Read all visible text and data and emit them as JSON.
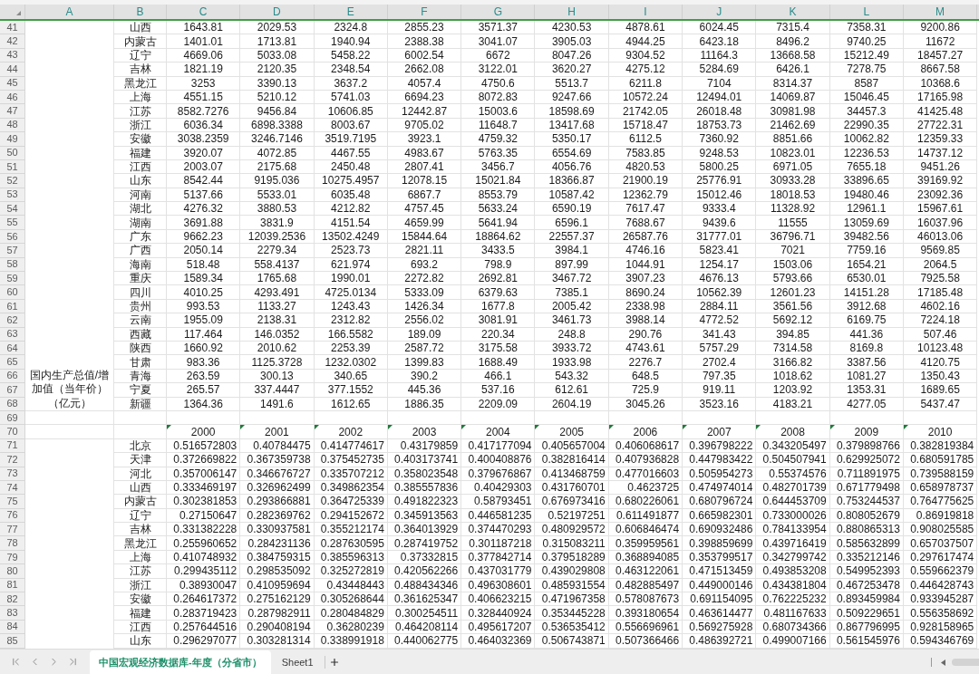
{
  "column_headers": [
    "A",
    "B",
    "C",
    "D",
    "E",
    "F",
    "G",
    "H",
    "I",
    "J",
    "K",
    "L",
    "M"
  ],
  "merged_label": "国内生产总值/增加值（当年价）（亿元）",
  "rows": [
    {
      "number": "41",
      "kind": "amount",
      "cells": [
        "山西",
        "1643.81",
        "2029.53",
        "2324.8",
        "2855.23",
        "3571.37",
        "4230.53",
        "4878.61",
        "6024.45",
        "7315.4",
        "7358.31",
        "9200.86"
      ]
    },
    {
      "number": "42",
      "kind": "amount",
      "cells": [
        "内蒙古",
        "1401.01",
        "1713.81",
        "1940.94",
        "2388.38",
        "3041.07",
        "3905.03",
        "4944.25",
        "6423.18",
        "8496.2",
        "9740.25",
        "11672"
      ]
    },
    {
      "number": "43",
      "kind": "amount",
      "cells": [
        "辽宁",
        "4669.06",
        "5033.08",
        "5458.22",
        "6002.54",
        "6672",
        "8047.26",
        "9304.52",
        "11164.3",
        "13668.58",
        "15212.49",
        "18457.27"
      ]
    },
    {
      "number": "44",
      "kind": "amount",
      "cells": [
        "吉林",
        "1821.19",
        "2120.35",
        "2348.54",
        "2662.08",
        "3122.01",
        "3620.27",
        "4275.12",
        "5284.69",
        "6426.1",
        "7278.75",
        "8667.58"
      ]
    },
    {
      "number": "45",
      "kind": "amount",
      "cells": [
        "黑龙江",
        "3253",
        "3390.13",
        "3637.2",
        "4057.4",
        "4750.6",
        "5513.7",
        "6211.8",
        "7104",
        "8314.37",
        "8587",
        "10368.6"
      ]
    },
    {
      "number": "46",
      "kind": "amount",
      "cells": [
        "上海",
        "4551.15",
        "5210.12",
        "5741.03",
        "6694.23",
        "8072.83",
        "9247.66",
        "10572.24",
        "12494.01",
        "14069.87",
        "15046.45",
        "17165.98"
      ]
    },
    {
      "number": "47",
      "kind": "amount",
      "cells": [
        "江苏",
        "8582.7276",
        "9456.84",
        "10606.85",
        "12442.87",
        "15003.6",
        "18598.69",
        "21742.05",
        "26018.48",
        "30981.98",
        "34457.3",
        "41425.48"
      ]
    },
    {
      "number": "48",
      "kind": "amount",
      "cells": [
        "浙江",
        "6036.34",
        "6898.3388",
        "8003.67",
        "9705.02",
        "11648.7",
        "13417.68",
        "15718.47",
        "18753.73",
        "21462.69",
        "22990.35",
        "27722.31"
      ]
    },
    {
      "number": "49",
      "kind": "amount",
      "cells": [
        "安徽",
        "3038.2359",
        "3246.7146",
        "3519.7195",
        "3923.1",
        "4759.32",
        "5350.17",
        "6112.5",
        "7360.92",
        "8851.66",
        "10062.82",
        "12359.33"
      ]
    },
    {
      "number": "50",
      "kind": "amount",
      "cells": [
        "福建",
        "3920.07",
        "4072.85",
        "4467.55",
        "4983.67",
        "5763.35",
        "6554.69",
        "7583.85",
        "9248.53",
        "10823.01",
        "12236.53",
        "14737.12"
      ]
    },
    {
      "number": "51",
      "kind": "amount",
      "cells": [
        "江西",
        "2003.07",
        "2175.68",
        "2450.48",
        "2807.41",
        "3456.7",
        "4056.76",
        "4820.53",
        "5800.25",
        "6971.05",
        "7655.18",
        "9451.26"
      ]
    },
    {
      "number": "52",
      "kind": "amount",
      "cells": [
        "山东",
        "8542.44",
        "9195.036",
        "10275.4957",
        "12078.15",
        "15021.84",
        "18366.87",
        "21900.19",
        "25776.91",
        "30933.28",
        "33896.65",
        "39169.92"
      ]
    },
    {
      "number": "53",
      "kind": "amount",
      "cells": [
        "河南",
        "5137.66",
        "5533.01",
        "6035.48",
        "6867.7",
        "8553.79",
        "10587.42",
        "12362.79",
        "15012.46",
        "18018.53",
        "19480.46",
        "23092.36"
      ]
    },
    {
      "number": "54",
      "kind": "amount",
      "cells": [
        "湖北",
        "4276.32",
        "3880.53",
        "4212.82",
        "4757.45",
        "5633.24",
        "6590.19",
        "7617.47",
        "9333.4",
        "11328.92",
        "12961.1",
        "15967.61"
      ]
    },
    {
      "number": "55",
      "kind": "amount",
      "cells": [
        "湖南",
        "3691.88",
        "3831.9",
        "4151.54",
        "4659.99",
        "5641.94",
        "6596.1",
        "7688.67",
        "9439.6",
        "11555",
        "13059.69",
        "16037.96"
      ]
    },
    {
      "number": "56",
      "kind": "amount",
      "cells": [
        "广东",
        "9662.23",
        "12039.2536",
        "13502.4249",
        "15844.64",
        "18864.62",
        "22557.37",
        "26587.76",
        "31777.01",
        "36796.71",
        "39482.56",
        "46013.06"
      ]
    },
    {
      "number": "57",
      "kind": "amount",
      "cells": [
        "广西",
        "2050.14",
        "2279.34",
        "2523.73",
        "2821.11",
        "3433.5",
        "3984.1",
        "4746.16",
        "5823.41",
        "7021",
        "7759.16",
        "9569.85"
      ]
    },
    {
      "number": "58",
      "kind": "amount",
      "cells": [
        "海南",
        "518.48",
        "558.4137",
        "621.974",
        "693.2",
        "798.9",
        "897.99",
        "1044.91",
        "1254.17",
        "1503.06",
        "1654.21",
        "2064.5"
      ]
    },
    {
      "number": "59",
      "kind": "amount",
      "cells": [
        "重庆",
        "1589.34",
        "1765.68",
        "1990.01",
        "2272.82",
        "2692.81",
        "3467.72",
        "3907.23",
        "4676.13",
        "5793.66",
        "6530.01",
        "7925.58"
      ]
    },
    {
      "number": "60",
      "kind": "amount",
      "cells": [
        "四川",
        "4010.25",
        "4293.491",
        "4725.0134",
        "5333.09",
        "6379.63",
        "7385.1",
        "8690.24",
        "10562.39",
        "12601.23",
        "14151.28",
        "17185.48"
      ]
    },
    {
      "number": "61",
      "kind": "amount",
      "cells": [
        "贵州",
        "993.53",
        "1133.27",
        "1243.43",
        "1426.34",
        "1677.8",
        "2005.42",
        "2338.98",
        "2884.11",
        "3561.56",
        "3912.68",
        "4602.16"
      ]
    },
    {
      "number": "62",
      "kind": "amount",
      "cells": [
        "云南",
        "1955.09",
        "2138.31",
        "2312.82",
        "2556.02",
        "3081.91",
        "3461.73",
        "3988.14",
        "4772.52",
        "5692.12",
        "6169.75",
        "7224.18"
      ]
    },
    {
      "number": "63",
      "kind": "amount",
      "cells": [
        "西藏",
        "117.464",
        "146.0352",
        "166.5582",
        "189.09",
        "220.34",
        "248.8",
        "290.76",
        "341.43",
        "394.85",
        "441.36",
        "507.46"
      ]
    },
    {
      "number": "64",
      "kind": "amount",
      "cells": [
        "陕西",
        "1660.92",
        "2010.62",
        "2253.39",
        "2587.72",
        "3175.58",
        "3933.72",
        "4743.61",
        "5757.29",
        "7314.58",
        "8169.8",
        "10123.48"
      ]
    },
    {
      "number": "65",
      "kind": "amount",
      "cells": [
        "甘肃",
        "983.36",
        "1125.3728",
        "1232.0302",
        "1399.83",
        "1688.49",
        "1933.98",
        "2276.7",
        "2702.4",
        "3166.82",
        "3387.56",
        "4120.75"
      ]
    },
    {
      "number": "66",
      "kind": "amount",
      "cells": [
        "青海",
        "263.59",
        "300.13",
        "340.65",
        "390.2",
        "466.1",
        "543.32",
        "648.5",
        "797.35",
        "1018.62",
        "1081.27",
        "1350.43"
      ]
    },
    {
      "number": "67",
      "kind": "amount",
      "cells": [
        "宁夏",
        "265.57",
        "337.4447",
        "377.1552",
        "445.36",
        "537.16",
        "612.61",
        "725.9",
        "919.11",
        "1203.92",
        "1353.31",
        "1689.65"
      ]
    },
    {
      "number": "68",
      "kind": "amount",
      "cells": [
        "新疆",
        "1364.36",
        "1491.6",
        "1612.65",
        "1886.35",
        "2209.09",
        "2604.19",
        "3045.26",
        "3523.16",
        "4183.21",
        "4277.05",
        "5437.47"
      ]
    },
    {
      "number": "69",
      "kind": "blank"
    },
    {
      "number": "70",
      "kind": "year_header",
      "cells": [
        {
          "text": "2000",
          "flagged": true
        },
        {
          "text": "2001",
          "flagged": true
        },
        {
          "text": "2002",
          "flagged": true
        },
        {
          "text": "2003",
          "flagged": true
        },
        {
          "text": "2004",
          "flagged": true
        },
        {
          "text": "2005",
          "flagged": true
        },
        {
          "text": "2006",
          "flagged": true
        },
        {
          "text": "2007",
          "flagged": true
        },
        {
          "text": "2008",
          "flagged": true
        },
        {
          "text": "2009",
          "flagged": true
        },
        {
          "text": "2010",
          "flagged": true
        }
      ]
    },
    {
      "number": "71",
      "kind": "ratio",
      "cells": [
        "北京",
        "0.516572803",
        "0.40784475",
        "0.414774617",
        "0.43179859",
        "0.417177094",
        "0.405657004",
        "0.406068617",
        "0.396798222",
        "0.343205497",
        "0.379898766",
        "0.382819384"
      ]
    },
    {
      "number": "72",
      "kind": "ratio",
      "cells": [
        "天津",
        "0.372669822",
        "0.367359738",
        "0.375452735",
        "0.403173741",
        "0.400408876",
        "0.382816414",
        "0.407936828",
        "0.447983422",
        "0.504507941",
        "0.629925072",
        "0.680591785"
      ]
    },
    {
      "number": "73",
      "kind": "ratio",
      "cells": [
        "河北",
        "0.357006147",
        "0.346676727",
        "0.335707212",
        "0.358023548",
        "0.379676867",
        "0.413468759",
        "0.477016603",
        "0.505954273",
        "0.55374576",
        "0.711891975",
        "0.739588159"
      ]
    },
    {
      "number": "74",
      "kind": "ratio",
      "cells": [
        "山西",
        "0.333469197",
        "0.326962499",
        "0.349862354",
        "0.385557836",
        "0.40429303",
        "0.431760701",
        "0.4623725",
        "0.474974014",
        "0.482701739",
        "0.671779498",
        "0.658978737"
      ]
    },
    {
      "number": "75",
      "kind": "ratio",
      "cells": [
        "内蒙古",
        "0.302381853",
        "0.293866881",
        "0.364725339",
        "0.491822323",
        "0.58793451",
        "0.676973416",
        "0.680226061",
        "0.680796724",
        "0.644453709",
        "0.753244537",
        "0.764775625"
      ]
    },
    {
      "number": "76",
      "kind": "ratio",
      "cells": [
        "辽宁",
        "0.27150647",
        "0.282369762",
        "0.294152672",
        "0.345913563",
        "0.446581235",
        "0.52197251",
        "0.611491877",
        "0.665982301",
        "0.733000026",
        "0.808052679",
        "0.86919818"
      ]
    },
    {
      "number": "77",
      "kind": "ratio",
      "cells": [
        "吉林",
        "0.331382228",
        "0.330937581",
        "0.355212174",
        "0.364013929",
        "0.374470293",
        "0.480929572",
        "0.606846474",
        "0.690932486",
        "0.784133954",
        "0.880865313",
        "0.908025585"
      ]
    },
    {
      "number": "78",
      "kind": "ratio",
      "cells": [
        "黑龙江",
        "0.255960652",
        "0.284231136",
        "0.287630595",
        "0.287419752",
        "0.301187218",
        "0.315083211",
        "0.359959561",
        "0.398859699",
        "0.439716419",
        "0.585632899",
        "0.657037507"
      ]
    },
    {
      "number": "79",
      "kind": "ratio",
      "cells": [
        "上海",
        "0.410748932",
        "0.384759315",
        "0.385596313",
        "0.37332815",
        "0.377842714",
        "0.379518289",
        "0.368894085",
        "0.353799517",
        "0.342799742",
        "0.335212146",
        "0.297617474"
      ]
    },
    {
      "number": "80",
      "kind": "ratio",
      "cells": [
        "江苏",
        "0.299435112",
        "0.298535092",
        "0.325272819",
        "0.420562266",
        "0.437031779",
        "0.439029808",
        "0.463122061",
        "0.471513459",
        "0.493853208",
        "0.549952393",
        "0.559662379"
      ]
    },
    {
      "number": "81",
      "kind": "ratio",
      "cells": [
        "浙江",
        "0.38930047",
        "0.410959694",
        "0.43448443",
        "0.488434346",
        "0.496308601",
        "0.485931554",
        "0.482885497",
        "0.449000146",
        "0.434381804",
        "0.467253478",
        "0.446428743"
      ]
    },
    {
      "number": "82",
      "kind": "ratio",
      "cells": [
        "安徽",
        "0.264617372",
        "0.275162129",
        "0.305268644",
        "0.361625347",
        "0.406623215",
        "0.471967358",
        "0.578087673",
        "0.691154095",
        "0.762225232",
        "0.893459984",
        "0.933945287"
      ]
    },
    {
      "number": "83",
      "kind": "ratio",
      "cells": [
        "福建",
        "0.283719423",
        "0.287982911",
        "0.280484829",
        "0.300254511",
        "0.328440924",
        "0.353445228",
        "0.393180654",
        "0.463614477",
        "0.481167633",
        "0.509229651",
        "0.556358692"
      ]
    },
    {
      "number": "84",
      "kind": "ratio",
      "cells": [
        "江西",
        "0.257644516",
        "0.290408194",
        "0.36280239",
        "0.464208114",
        "0.495617207",
        "0.536535412",
        "0.556696961",
        "0.569275928",
        "0.680734366",
        "0.867796995",
        "0.928158965"
      ]
    },
    {
      "number": "85",
      "kind": "ratio",
      "cells": [
        "山东",
        "0.296297077",
        "0.303281314",
        "0.338991918",
        "0.440062775",
        "0.464032369",
        "0.506743871",
        "0.507366466",
        "0.486392721",
        "0.499007166",
        "0.561545976",
        "0.594346769"
      ]
    }
  ],
  "sheet_tabs": [
    {
      "label": "中国宏观经济数据库-年度（分省市）",
      "selected": true
    },
    {
      "label": "Sheet1",
      "selected": false
    }
  ]
}
